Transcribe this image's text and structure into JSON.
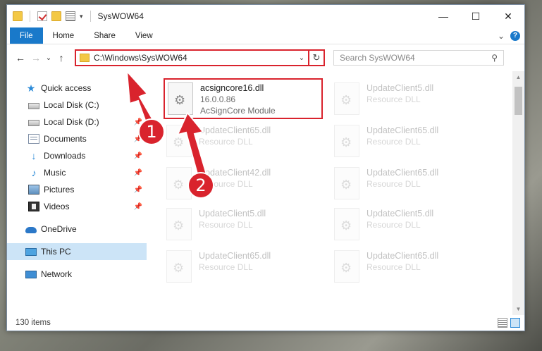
{
  "window": {
    "title": "SysWOW64",
    "controls": {
      "minimize": "—",
      "maximize": "☐",
      "close": "✕"
    }
  },
  "ribbon": {
    "tabs": [
      "File",
      "Home",
      "Share",
      "View"
    ],
    "expand": "⌄",
    "help": "?"
  },
  "nav": {
    "back": "←",
    "forward": "→",
    "recent": "⌄",
    "up": "↑"
  },
  "address": {
    "path": "C:\\Windows\\SysWOW64",
    "dropdown": "⌄",
    "refresh": "↻"
  },
  "search": {
    "placeholder": "Search SysWOW64",
    "icon": "search-icon"
  },
  "sidebar": {
    "quick_access": "Quick access",
    "items": [
      {
        "label": "Local Disk (C:)",
        "icon": "disk-icon",
        "pinned": false
      },
      {
        "label": "Local Disk (D:)",
        "icon": "disk-icon",
        "pinned": true
      },
      {
        "label": "Documents",
        "icon": "documents-icon",
        "pinned": true
      },
      {
        "label": "Downloads",
        "icon": "downloads-icon",
        "pinned": true
      },
      {
        "label": "Music",
        "icon": "music-icon",
        "pinned": true
      },
      {
        "label": "Pictures",
        "icon": "pictures-icon",
        "pinned": true
      },
      {
        "label": "Videos",
        "icon": "videos-icon",
        "pinned": true
      }
    ],
    "onedrive": "OneDrive",
    "this_pc": "This PC",
    "network": "Network"
  },
  "files": [
    {
      "name": "acsigncore16.dll",
      "line2": "16.0.0.86",
      "line3": "AcSignCore Module",
      "highlighted": true
    },
    {
      "name": "UpdateClient5.dll",
      "line2": "Resource DLL",
      "faded": true
    },
    {
      "name": "UpdateClient65.dll",
      "line2": "Resource DLL",
      "faded": true
    },
    {
      "name": "UpdateClient65.dll",
      "line2": "Resource DLL",
      "faded": true
    },
    {
      "name": "UpdateClient42.dll",
      "line2": "Resource DLL",
      "faded": true
    },
    {
      "name": "UpdateClient65.dll",
      "line2": "Resource DLL",
      "faded": true
    },
    {
      "name": "UpdateClient5.dll",
      "line2": "Resource DLL",
      "faded": true
    },
    {
      "name": "UpdateClient5.dll",
      "line2": "Resource DLL",
      "faded": true
    },
    {
      "name": "UpdateClient65.dll",
      "line2": "Resource DLL",
      "faded": true
    },
    {
      "name": "UpdateClient65.dll",
      "line2": "Resource DLL",
      "faded": true
    }
  ],
  "status": {
    "item_count": "130 items"
  },
  "annotations": {
    "step1": "1",
    "step2": "2",
    "color": "#d9232d"
  }
}
